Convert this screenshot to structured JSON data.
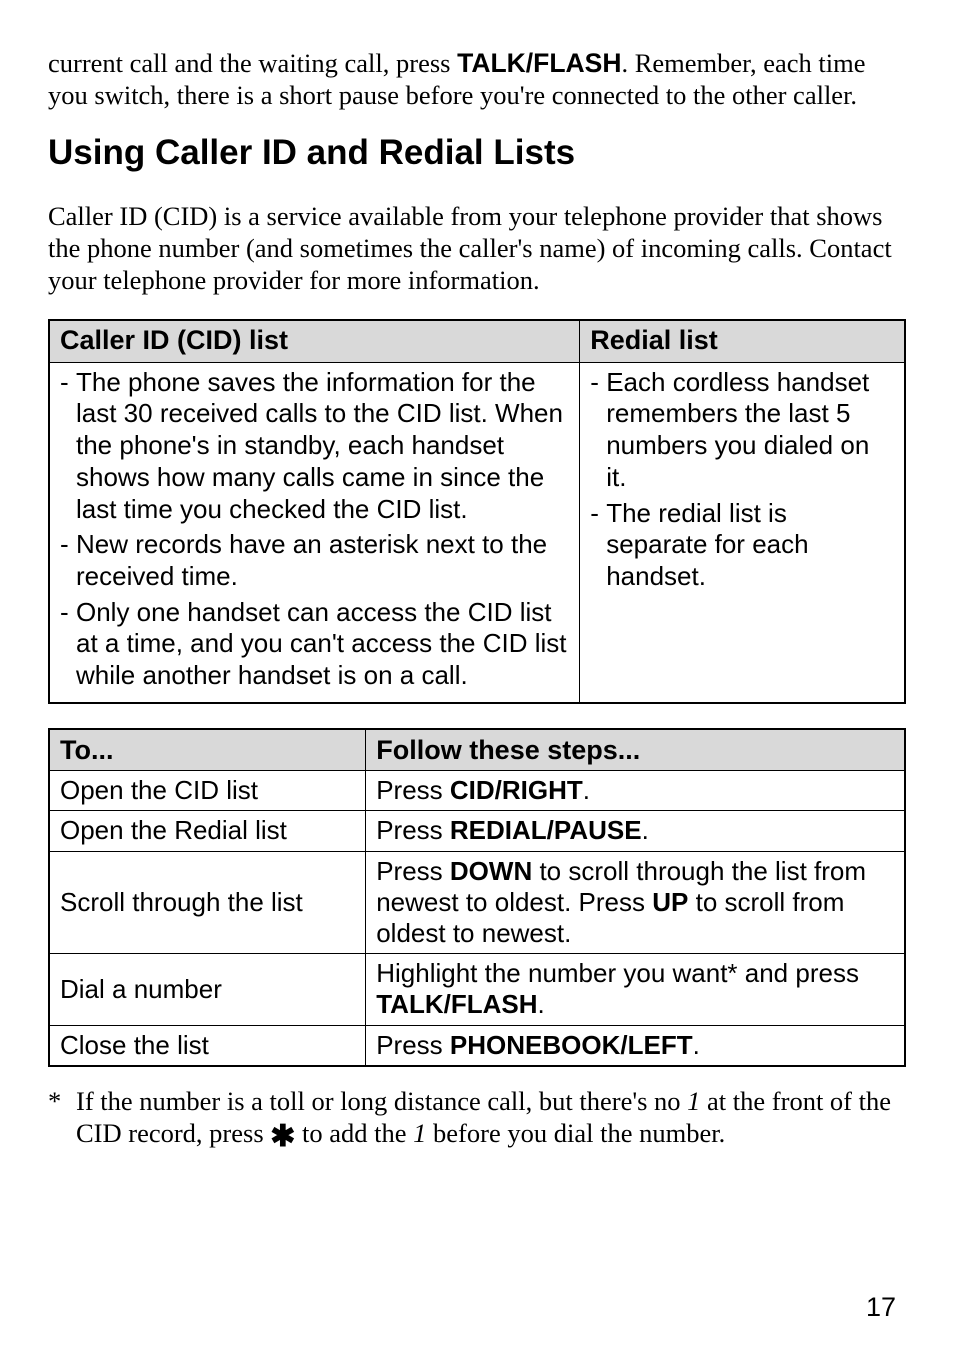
{
  "intro": {
    "seg1": "current call and the waiting call, press ",
    "key": "TALK/FLASH",
    "seg2": ". Remember, each time you switch, there is a short pause before you're connected to the other caller."
  },
  "section": {
    "title": "Using Caller ID and Redial Lists",
    "body": "Caller ID (CID) is a service available from your telephone provider that shows the phone number (and sometimes the caller's name) of incoming calls. Contact your telephone provider for more information."
  },
  "boxTable": {
    "headers": {
      "cid": "Caller ID (CID) list",
      "redial": "Redial list"
    },
    "cidBullets": [
      "The phone saves the information for the last 30 received calls to the CID list. When the phone's in standby, each handset shows how many calls came in since the last time you checked the CID list.",
      "New records have an asterisk next to the received time.",
      "Only one handset can access the CID list at a time, and you can't access the CID list while another handset is on a call."
    ],
    "redialBullets": [
      "Each cordless handset remembers the last 5 numbers you dialed on it.",
      "The redial list is separate for each handset."
    ]
  },
  "stepsTable": {
    "header": {
      "to": "To...",
      "steps": "Follow these steps..."
    },
    "rows": [
      {
        "to": "Open the CID list",
        "pre": "Press ",
        "key": "CID/RIGHT",
        "post": "."
      },
      {
        "to": "Open the Redial list",
        "pre": "Press ",
        "key": "REDIAL/PAUSE",
        "post": "."
      },
      {
        "to": "Scroll through the list",
        "pre": "Press ",
        "key": "DOWN",
        "mid": " to scroll through the list from newest to oldest. Press ",
        "key2": "UP",
        "post": " to scroll from oldest to newest."
      },
      {
        "to": "Dial a number",
        "pre": "Highlight the number you want* and press ",
        "key": "TALK/FLASH",
        "post": "."
      },
      {
        "to": "Close the list",
        "pre": "Press ",
        "key": "PHONEBOOK/LEFT",
        "post": "."
      }
    ]
  },
  "footnote": {
    "ast": "*",
    "seg1": "If the number is a toll or long distance call, but there's no ",
    "one1": "1",
    "seg2": " at the front of the CID record, press ",
    "star": "✱",
    "seg3": " to add the ",
    "one2": "1",
    "seg4": " before you dial the number."
  },
  "pageNumber": "17"
}
